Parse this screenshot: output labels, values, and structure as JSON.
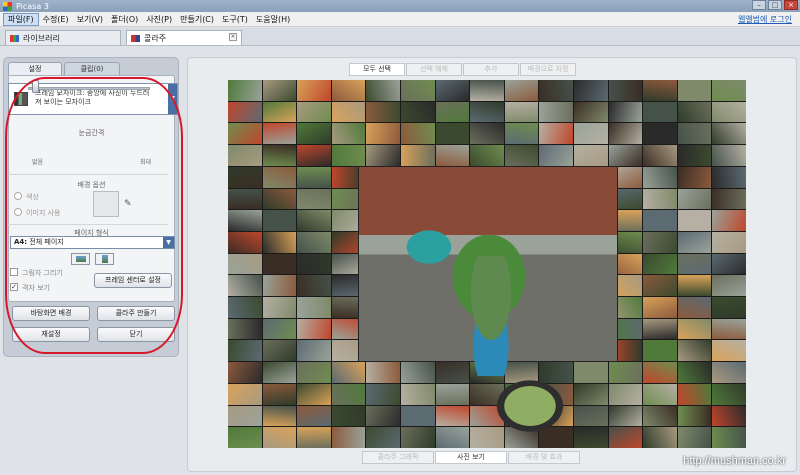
{
  "window": {
    "title": "Picasa 3"
  },
  "menu": {
    "items": [
      "파일(F)",
      "수정(E)",
      "보기(V)",
      "폴더(O)",
      "사진(P)",
      "만들기(C)",
      "도구(T)",
      "도움말(H)"
    ],
    "signin": "웹앨범에 로그인"
  },
  "doc_tabs": [
    {
      "label": "라이브러리"
    },
    {
      "label": "콜라주"
    }
  ],
  "left_panel": {
    "tabs": [
      "설정",
      "클립(0)"
    ],
    "layout_text": "프레임 모자이크: 중앙에 사진이 두드러져 보이는 모자이크",
    "grid_spacing": {
      "title": "눈금간격",
      "min_label": "없음",
      "max_label": "최대",
      "value_fraction": 0.05
    },
    "background": {
      "title": "배경 옵션",
      "option1": "색상",
      "option2": "이미지 사용"
    },
    "page_format": {
      "title": "페이지 형식",
      "value_bold": "A4:",
      "value": " 전체 페이지"
    },
    "checkboxes": {
      "draw_shadow": "그림자 그리기",
      "show_grid": "격자 보기"
    },
    "set_frame_center_button": "프레임 센터로 설정",
    "buttons": {
      "wallpaper": "바탕화면 배경",
      "create": "콜라주 만들기",
      "reset": "재설정",
      "close": "닫기"
    }
  },
  "main": {
    "top_tabs": [
      "모두 선택",
      "선택 해제",
      "추가",
      "배경으로 지정"
    ],
    "bottom_tabs": [
      "콜라주 그래픽",
      "사진 보기",
      "배경 및 효과"
    ]
  },
  "watermark": "http://mushman.co.kr",
  "colors": {
    "annotation": "#d8182a",
    "accent_blue": "#4a6fa5",
    "link": "#1d5bb5"
  }
}
